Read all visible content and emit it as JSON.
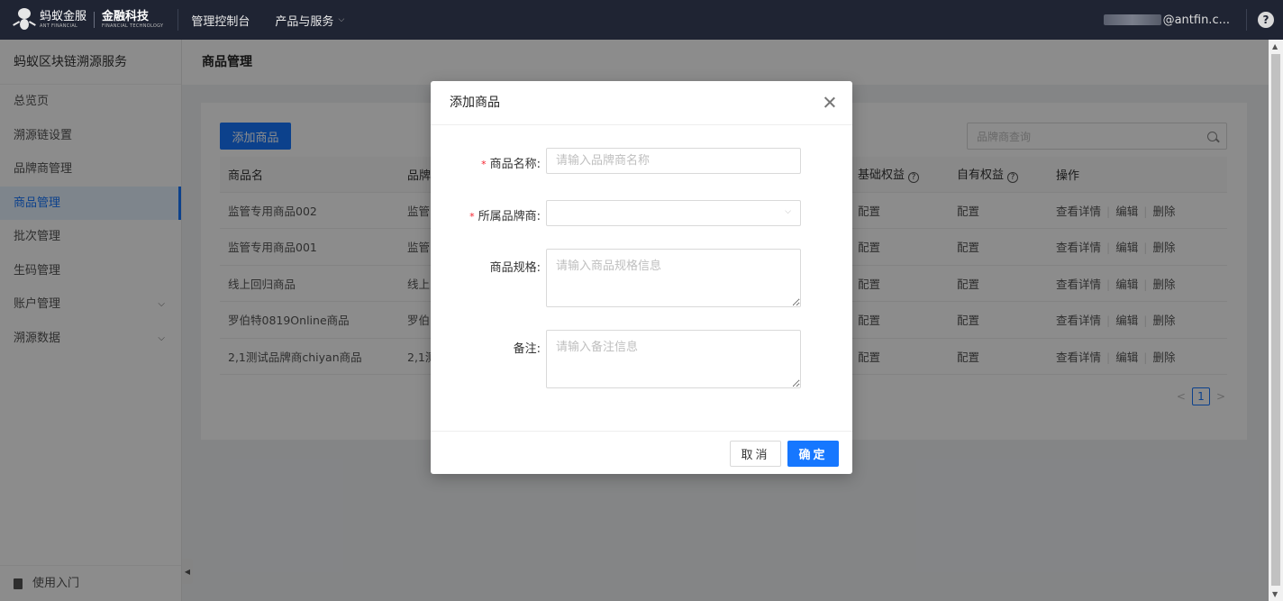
{
  "topbar": {
    "logo_ant_cn": "蚂蚁金服",
    "logo_ant_en": "ANT FINANCIAL",
    "logo_fin_cn": "金融科技",
    "logo_fin_en": "FINANCIAL TECHNOLOGY",
    "nav": [
      {
        "label": "管理控制台"
      },
      {
        "label": "产品与服务"
      }
    ],
    "email_suffix": "@antfin.c...",
    "help_label": "?"
  },
  "sidebar": {
    "title": "蚂蚁区块链溯源服务",
    "items": [
      {
        "label": "总览页"
      },
      {
        "label": "溯源链设置"
      },
      {
        "label": "品牌商管理"
      },
      {
        "label": "商品管理"
      },
      {
        "label": "批次管理"
      },
      {
        "label": "生码管理"
      },
      {
        "label": "账户管理"
      },
      {
        "label": "溯源数据"
      }
    ],
    "footer_label": "使用入门"
  },
  "main": {
    "page_title": "商品管理",
    "add_button": "添加商品",
    "search_placeholder": "品牌商查询",
    "columns": [
      "商品名",
      "品牌",
      "基础权益",
      "自有权益",
      "操作"
    ],
    "rows": [
      {
        "name": "监管专用商品002",
        "brand": "监管",
        "base": "配置",
        "own": "配置"
      },
      {
        "name": "监管专用商品001",
        "brand": "监管",
        "base": "配置",
        "own": "配置"
      },
      {
        "name": "线上回归商品",
        "brand": "线上",
        "base": "配置",
        "own": "配置"
      },
      {
        "name": "罗伯特0819Online商品",
        "brand": "罗伯",
        "base": "配置",
        "own": "配置"
      },
      {
        "name": "2,1测试品牌商chiyan商品",
        "brand": "2,1测",
        "base": "配置",
        "own": "配置"
      }
    ],
    "actions": {
      "view": "查看详情",
      "edit": "编辑",
      "delete": "删除"
    },
    "pagination": {
      "current": "1"
    }
  },
  "modal": {
    "title": "添加商品",
    "fields": {
      "name_label": "商品名称:",
      "name_placeholder": "请输入品牌商名称",
      "brand_label": "所属品牌商:",
      "spec_label": "商品规格:",
      "spec_placeholder": "请输入商品规格信息",
      "note_label": "备注:",
      "note_placeholder": "请输入备注信息",
      "required_mark": "*"
    },
    "cancel": "取消",
    "ok": "确定"
  },
  "colors": {
    "topbar_bg": "#1f2433",
    "primary": "#1677ff",
    "required": "#f5222d"
  }
}
